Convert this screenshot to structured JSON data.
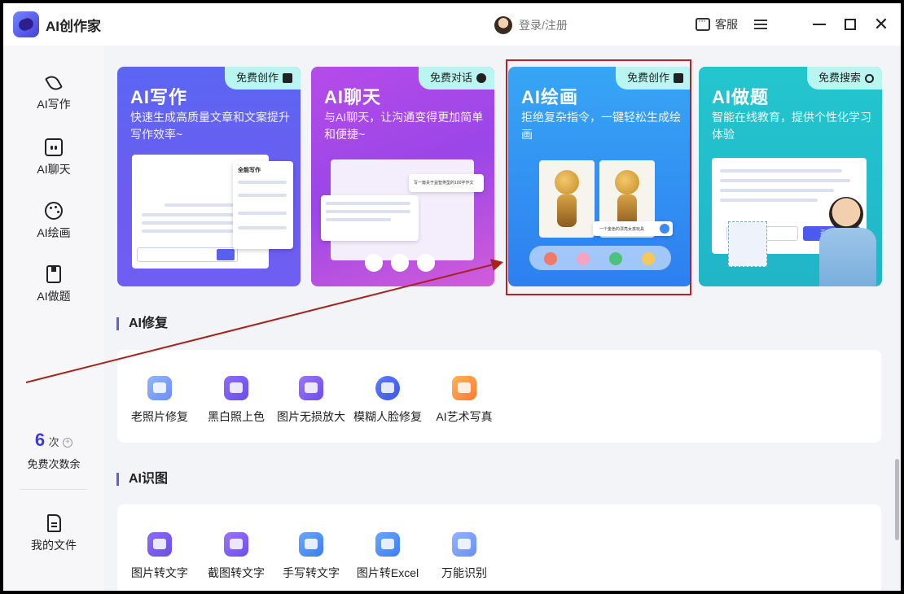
{
  "app": {
    "title": "AI创作家",
    "login": "登录/注册",
    "support": "客服"
  },
  "sidebar": {
    "items": [
      {
        "label": "AI写作",
        "icon": "pen-icon"
      },
      {
        "label": "AI聊天",
        "icon": "chat-bot-icon"
      },
      {
        "label": "AI绘画",
        "icon": "palette-icon"
      },
      {
        "label": "AI做题",
        "icon": "task-icon"
      }
    ],
    "credits": {
      "count": "6",
      "unit": "次",
      "label": "免费次数余"
    },
    "files": "我的文件"
  },
  "cards": {
    "write": {
      "title": "AI写作",
      "desc": "快速生成高质量文章和文案提升写作效率~",
      "badge": "免费创作"
    },
    "chat": {
      "title": "AI聊天",
      "desc": "与AI聊天，让沟通变得更加简单和便捷~",
      "badge": "免费对话"
    },
    "draw": {
      "title": "AI绘画",
      "desc": "拒绝复杂指令，一键轻松生成绘画",
      "badge": "免费创作"
    },
    "quiz": {
      "title": "AI做题",
      "desc": "智能在线教育，提供个性化学习体验",
      "badge": "免费搜索"
    }
  },
  "mock_text": {
    "write_panel": "全能写作",
    "chat_bubble": "写一篇关于益智类型的100字作文",
    "draw_caption": "一个金色的漂亮女孩玩具",
    "quiz_button": "开始生成"
  },
  "sections": {
    "repair": {
      "title": "AI修复",
      "tools": [
        "老照片修复",
        "黑白照上色",
        "图片无损放大",
        "模糊人脸修复",
        "AI艺术写真"
      ]
    },
    "ocr": {
      "title": "AI识图",
      "tools": [
        "图片转文字",
        "截图转文字",
        "手写转文字",
        "图片转Excel",
        "万能识别"
      ]
    }
  },
  "colors": {
    "accent": "#5b5ff0",
    "highlight": "#b8231f",
    "credit": "#3b3bd6"
  }
}
